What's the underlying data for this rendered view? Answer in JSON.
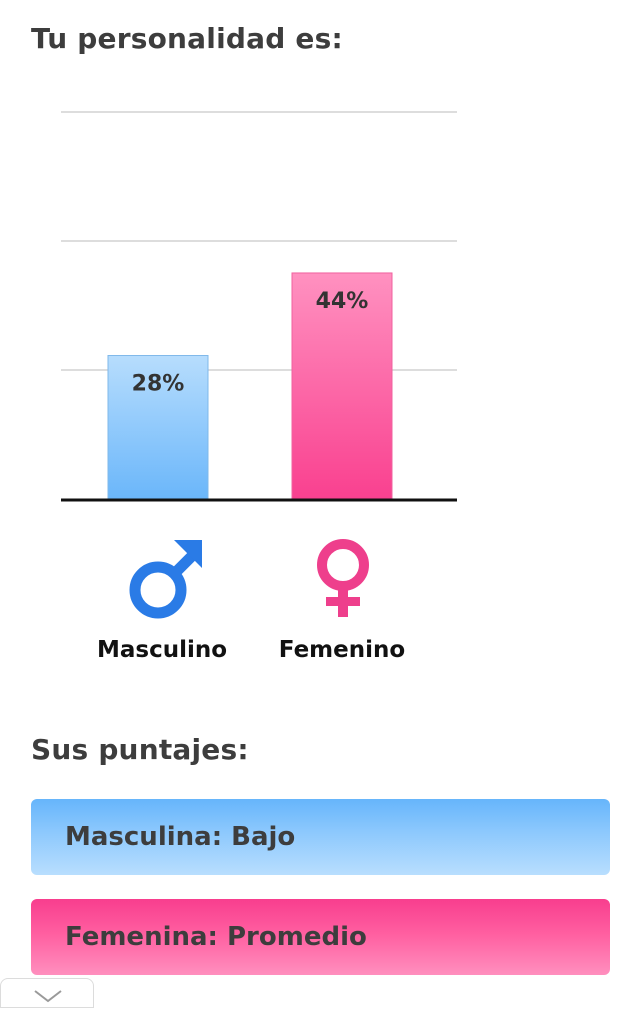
{
  "title": "Tu personalidad es:",
  "chart_data": {
    "type": "bar",
    "categories": [
      "Masculino",
      "Femenino"
    ],
    "values": [
      28,
      44
    ],
    "value_labels": [
      "28%",
      "44%"
    ],
    "ylim": [
      0,
      100
    ],
    "grid": true,
    "colors": {
      "Masculino": [
        "#b7ddfd",
        "#6ab6fa"
      ],
      "Femenino": [
        "#ff91c0",
        "#f9408f"
      ]
    }
  },
  "symbols": {
    "male": {
      "icon": "male-symbol-icon",
      "color": "#2a7be6"
    },
    "female": {
      "icon": "female-symbol-icon",
      "color": "#ee3f8c"
    }
  },
  "scores": {
    "heading": "Sus puntajes:",
    "masculine": "Masculina: Bajo",
    "feminine": "Femenina: Promedio"
  }
}
